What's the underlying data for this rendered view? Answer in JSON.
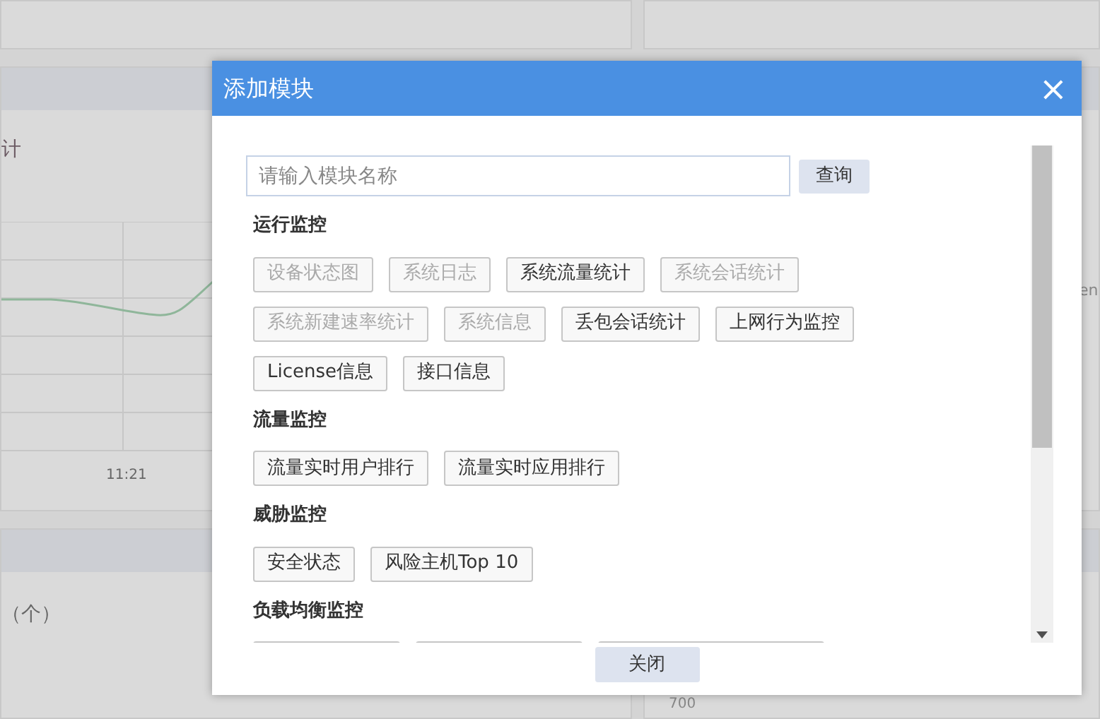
{
  "background": {
    "panel_title_fragment": "计",
    "x_tick": "11:21",
    "lower_title_fragment": "（个）",
    "right_fragment": "en",
    "y_tick": "700"
  },
  "dialog": {
    "title": "添加模块",
    "close_icon": "×",
    "search": {
      "placeholder": "请输入模块名称",
      "button": "查询"
    },
    "groups": [
      {
        "title": "运行监控",
        "items": [
          {
            "label": "设备状态图",
            "disabled": true
          },
          {
            "label": "系统日志",
            "disabled": true
          },
          {
            "label": "系统流量统计",
            "disabled": false
          },
          {
            "label": "系统会话统计",
            "disabled": true
          },
          {
            "label": "系统新建速率统计",
            "disabled": true
          },
          {
            "label": "系统信息",
            "disabled": true
          },
          {
            "label": "丢包会话统计",
            "disabled": false
          },
          {
            "label": "上网行为监控",
            "disabled": false
          },
          {
            "label": "License信息",
            "disabled": false
          },
          {
            "label": "接口信息",
            "disabled": false
          }
        ]
      },
      {
        "title": "流量监控",
        "items": [
          {
            "label": "流量实时用户排行",
            "disabled": false
          },
          {
            "label": "流量实时应用排行",
            "disabled": false
          }
        ]
      },
      {
        "title": "威胁监控",
        "items": [
          {
            "label": "安全状态",
            "disabled": false
          },
          {
            "label": "风险主机Top 10",
            "disabled": false
          }
        ]
      },
      {
        "title": "负载均衡监控",
        "items": [
          {
            "kind": "cut"
          },
          {
            "kind": "cut"
          },
          {
            "kind": "cut"
          }
        ]
      }
    ],
    "footer_button": "关闭"
  }
}
